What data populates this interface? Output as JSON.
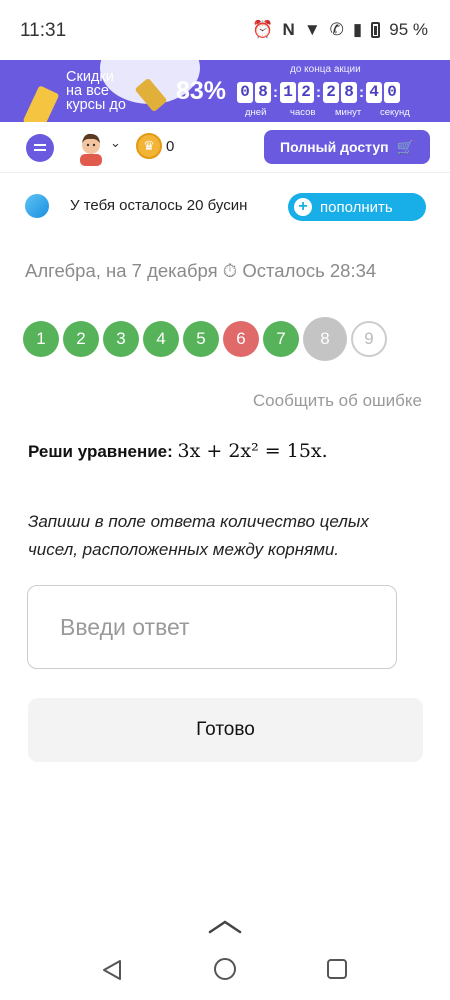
{
  "status_bar": {
    "time": "11:31",
    "battery": "95 %"
  },
  "promo": {
    "text_lines": [
      "Скидки",
      "на все",
      "курсы до"
    ],
    "percent": "83%",
    "until_label": "до конца акции",
    "countdown": [
      {
        "digits": [
          "0",
          "8"
        ],
        "unit": "дней"
      },
      {
        "digits": [
          "1",
          "2"
        ],
        "unit": "часов"
      },
      {
        "digits": [
          "2",
          "8"
        ],
        "unit": "минут"
      },
      {
        "digits": [
          "4",
          "0"
        ],
        "unit": "секунд"
      }
    ]
  },
  "header": {
    "coins": "0",
    "full_access_label": "Полный доступ"
  },
  "beads": {
    "text": "У тебя осталось 20 бусин",
    "refill_label": "пополнить"
  },
  "test": {
    "subject": "Алгебра, на 7 декабря",
    "timer": "Осталось 28:34",
    "questions": [
      {
        "n": "1",
        "state": "correct"
      },
      {
        "n": "2",
        "state": "correct"
      },
      {
        "n": "3",
        "state": "correct"
      },
      {
        "n": "4",
        "state": "correct"
      },
      {
        "n": "5",
        "state": "correct"
      },
      {
        "n": "6",
        "state": "wrong"
      },
      {
        "n": "7",
        "state": "correct"
      },
      {
        "n": "8",
        "state": "current"
      },
      {
        "n": "9",
        "state": "unanswered"
      }
    ],
    "report_label": "Сообщить об ошибке",
    "task_prefix": "Реши уравнение:",
    "task_equation": "3x + 2x² = 15x.",
    "instruction": "Запиши в поле ответа количество целых чисел, расположенных между корнями.",
    "answer_placeholder": "Введи ответ",
    "answer_value": "",
    "done_label": "Готово"
  },
  "colors": {
    "brand": "#6a5ae0",
    "correct": "#56b35a",
    "wrong": "#e06a6a",
    "current": "#c4c4c4",
    "refill": "#18aee8"
  }
}
